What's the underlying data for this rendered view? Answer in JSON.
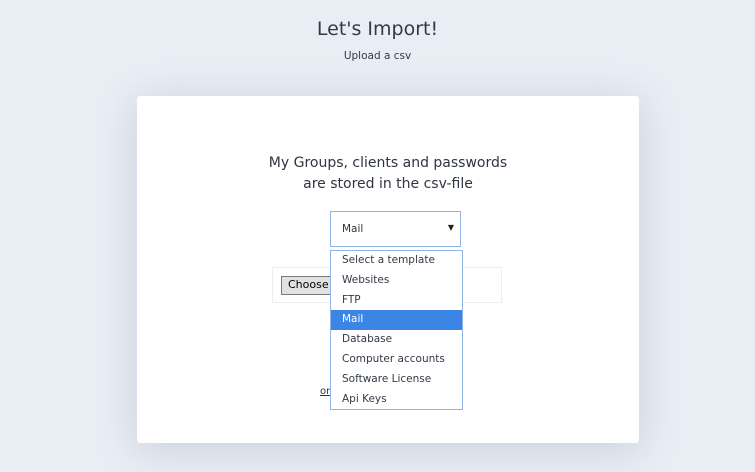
{
  "header": {
    "title": "Let's Import!",
    "subtitle": "Upload a csv"
  },
  "card": {
    "description_line1": "My Groups, clients and passwords",
    "description_line2": "are stored in the csv-file",
    "template_select": {
      "selected_value": "Mail",
      "options": [
        "Select a template",
        "Websites",
        "FTP",
        "Mail",
        "Database",
        "Computer accounts",
        "Software License",
        "Api Keys"
      ],
      "selected_index": 3
    },
    "file_input": {
      "button_label": "Choose"
    },
    "or_link": "or"
  },
  "colors": {
    "background": "#e9edf4",
    "card": "#ffffff",
    "selected_option": "#3b86e4",
    "select_border": "#8fb4e8"
  }
}
